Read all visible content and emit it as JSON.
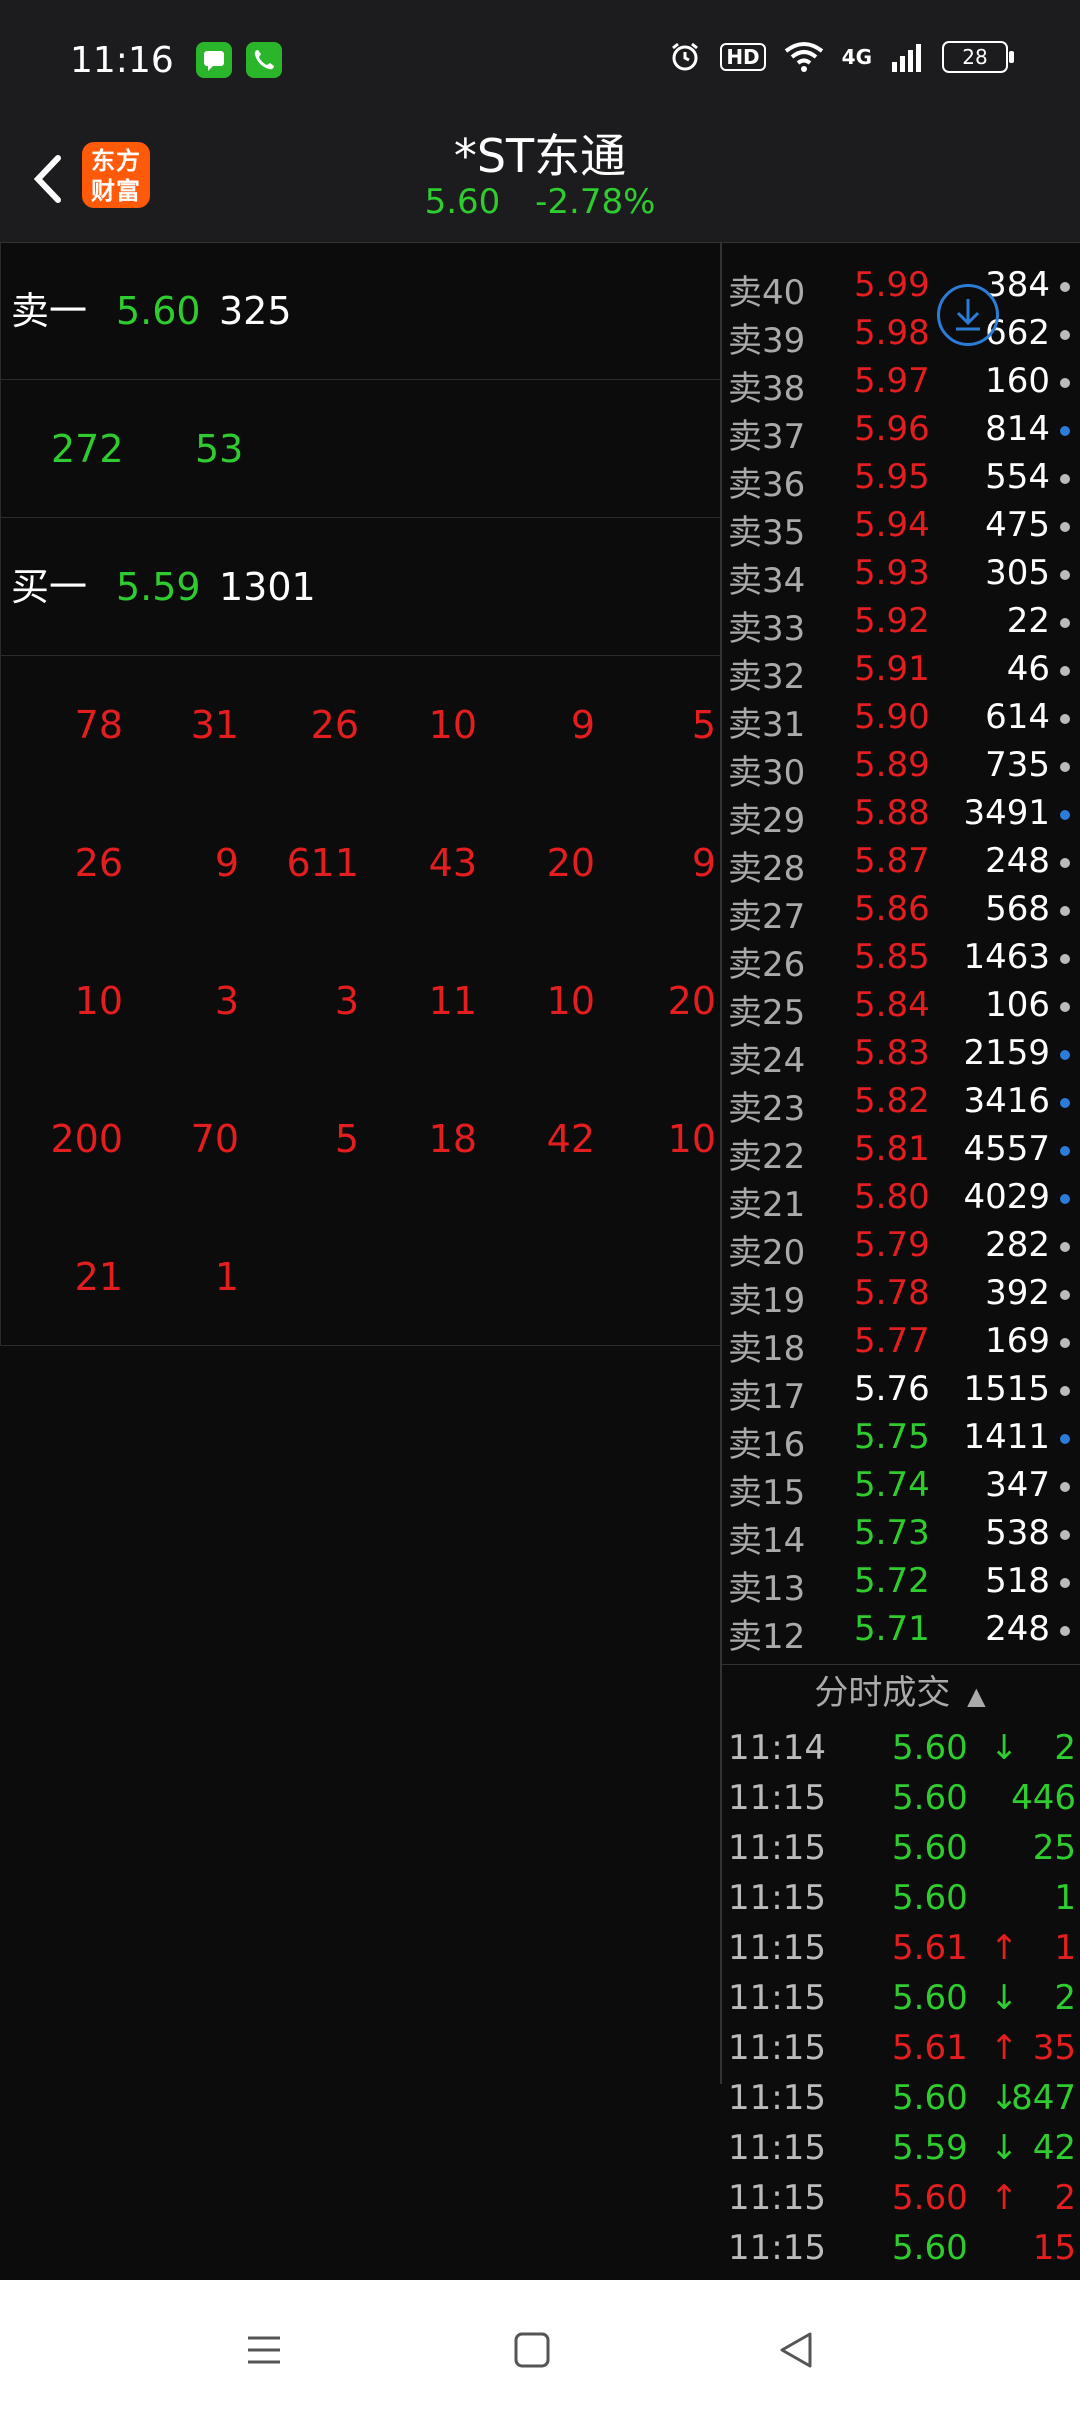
{
  "status": {
    "time": "11:16",
    "network": "4G",
    "hd": "HD",
    "battery": "28"
  },
  "header": {
    "logo_text_1": "东方",
    "logo_text_2": "财富",
    "title": "*ST东通",
    "price": "5.60",
    "change": "-2.78%"
  },
  "quotes": {
    "sell1": {
      "label": "卖一",
      "price": "5.60",
      "volume": "325"
    },
    "middle": {
      "a": "272",
      "b": "53"
    },
    "buy1": {
      "label": "买一",
      "price": "5.59",
      "volume": "1301"
    },
    "queue_rows": [
      [
        "78",
        "31",
        "26",
        "10",
        "9",
        "5"
      ],
      [
        "26",
        "9",
        "611",
        "43",
        "20",
        "9"
      ],
      [
        "10",
        "3",
        "3",
        "11",
        "10",
        "20"
      ],
      [
        "200",
        "70",
        "5",
        "18",
        "42",
        "10"
      ],
      [
        "21",
        "1",
        "",
        "",
        "",
        ""
      ]
    ]
  },
  "orderbook": [
    {
      "label": "卖40",
      "price": "5.99",
      "vol": "384",
      "c": "red",
      "dot": "gray"
    },
    {
      "label": "卖39",
      "price": "5.98",
      "vol": "662",
      "c": "red",
      "dot": "gray"
    },
    {
      "label": "卖38",
      "price": "5.97",
      "vol": "160",
      "c": "red",
      "dot": "gray"
    },
    {
      "label": "卖37",
      "price": "5.96",
      "vol": "814",
      "c": "red",
      "dot": "blue"
    },
    {
      "label": "卖36",
      "price": "5.95",
      "vol": "554",
      "c": "red",
      "dot": "gray"
    },
    {
      "label": "卖35",
      "price": "5.94",
      "vol": "475",
      "c": "red",
      "dot": "gray"
    },
    {
      "label": "卖34",
      "price": "5.93",
      "vol": "305",
      "c": "red",
      "dot": "gray"
    },
    {
      "label": "卖33",
      "price": "5.92",
      "vol": "22",
      "c": "red",
      "dot": "gray"
    },
    {
      "label": "卖32",
      "price": "5.91",
      "vol": "46",
      "c": "red",
      "dot": "gray"
    },
    {
      "label": "卖31",
      "price": "5.90",
      "vol": "614",
      "c": "red",
      "dot": "gray"
    },
    {
      "label": "卖30",
      "price": "5.89",
      "vol": "735",
      "c": "red",
      "dot": "gray"
    },
    {
      "label": "卖29",
      "price": "5.88",
      "vol": "3491",
      "c": "red",
      "dot": "blue"
    },
    {
      "label": "卖28",
      "price": "5.87",
      "vol": "248",
      "c": "red",
      "dot": "gray"
    },
    {
      "label": "卖27",
      "price": "5.86",
      "vol": "568",
      "c": "red",
      "dot": "gray"
    },
    {
      "label": "卖26",
      "price": "5.85",
      "vol": "1463",
      "c": "red",
      "dot": "gray"
    },
    {
      "label": "卖25",
      "price": "5.84",
      "vol": "106",
      "c": "red",
      "dot": "gray"
    },
    {
      "label": "卖24",
      "price": "5.83",
      "vol": "2159",
      "c": "red",
      "dot": "blue"
    },
    {
      "label": "卖23",
      "price": "5.82",
      "vol": "3416",
      "c": "red",
      "dot": "blue"
    },
    {
      "label": "卖22",
      "price": "5.81",
      "vol": "4557",
      "c": "red",
      "dot": "blue"
    },
    {
      "label": "卖21",
      "price": "5.80",
      "vol": "4029",
      "c": "red",
      "dot": "blue"
    },
    {
      "label": "卖20",
      "price": "5.79",
      "vol": "282",
      "c": "red",
      "dot": "gray"
    },
    {
      "label": "卖19",
      "price": "5.78",
      "vol": "392",
      "c": "red",
      "dot": "gray"
    },
    {
      "label": "卖18",
      "price": "5.77",
      "vol": "169",
      "c": "red",
      "dot": "gray"
    },
    {
      "label": "卖17",
      "price": "5.76",
      "vol": "1515",
      "c": "white",
      "dot": "gray"
    },
    {
      "label": "卖16",
      "price": "5.75",
      "vol": "1411",
      "c": "green",
      "dot": "blue"
    },
    {
      "label": "卖15",
      "price": "5.74",
      "vol": "347",
      "c": "green",
      "dot": "gray"
    },
    {
      "label": "卖14",
      "price": "5.73",
      "vol": "538",
      "c": "green",
      "dot": "gray"
    },
    {
      "label": "卖13",
      "price": "5.72",
      "vol": "518",
      "c": "green",
      "dot": "gray"
    },
    {
      "label": "卖12",
      "price": "5.71",
      "vol": "248",
      "c": "green",
      "dot": "gray"
    }
  ],
  "ticks_title": "分时成交",
  "ticks": [
    {
      "time": "11:14",
      "price": "5.60",
      "arrow": "↓",
      "ac": "green",
      "vol": "2",
      "vc": "green"
    },
    {
      "time": "11:15",
      "price": "5.60",
      "arrow": "",
      "ac": "green",
      "vol": "446",
      "vc": "green"
    },
    {
      "time": "11:15",
      "price": "5.60",
      "arrow": "",
      "ac": "green",
      "vol": "25",
      "vc": "green"
    },
    {
      "time": "11:15",
      "price": "5.60",
      "arrow": "",
      "ac": "green",
      "vol": "1",
      "vc": "green"
    },
    {
      "time": "11:15",
      "price": "5.61",
      "arrow": "↑",
      "ac": "red",
      "vol": "1",
      "vc": "red"
    },
    {
      "time": "11:15",
      "price": "5.60",
      "arrow": "↓",
      "ac": "green",
      "vol": "2",
      "vc": "green"
    },
    {
      "time": "11:15",
      "price": "5.61",
      "arrow": "↑",
      "ac": "red",
      "vol": "35",
      "vc": "red"
    },
    {
      "time": "11:15",
      "price": "5.60",
      "arrow": "↓",
      "ac": "green",
      "vol": "847",
      "vc": "green"
    },
    {
      "time": "11:15",
      "price": "5.59",
      "arrow": "↓",
      "ac": "green",
      "vol": "42",
      "vc": "green"
    },
    {
      "time": "11:15",
      "price": "5.60",
      "arrow": "↑",
      "ac": "red",
      "vol": "2",
      "vc": "red"
    },
    {
      "time": "11:15",
      "price": "5.60",
      "arrow": "",
      "ac": "green",
      "vol": "15",
      "vc": "red"
    }
  ],
  "colors": {
    "up": "#e41e1e",
    "down": "#2fcc2f",
    "neutral": "#ffffff",
    "accent": "#2a7cd6"
  }
}
